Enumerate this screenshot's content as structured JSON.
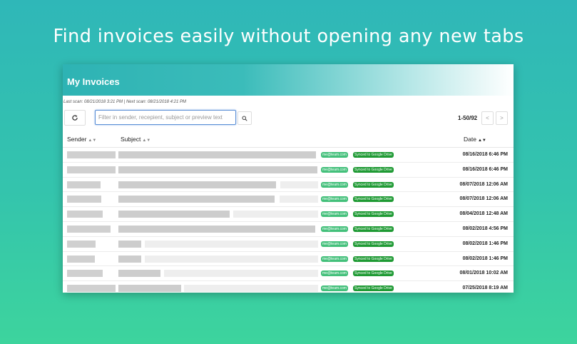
{
  "headline": "Find invoices easily without opening any new tabs",
  "panel": {
    "title": "My Invoices",
    "scan_info": "Last scan: 08/21/2018 3:21 PM | Next scan: 08/21/2018 4:21 PM"
  },
  "toolbar": {
    "refresh_icon": "refresh-icon",
    "filter_placeholder": "Filter in sender, recepient, subject or preview text",
    "search_icon": "search-icon",
    "pagination": "1-50/92",
    "prev_label": "<",
    "next_label": ">"
  },
  "table": {
    "columns": {
      "sender": "Sender",
      "subject": "Subject",
      "date": "Date",
      "sender_sort": "▲▼",
      "subject_sort": "▲▼",
      "date_sort": "▲▼"
    },
    "rows": [
      {
        "email_badge": "me@team.com",
        "sync_badge": "Synced to Google Drive",
        "date": "08/16/2018 6:46 PM"
      },
      {
        "email_badge": "me@team.com",
        "sync_badge": "Synced to Google Drive",
        "date": "08/16/2018 6:46 PM"
      },
      {
        "email_badge": "me@team.com",
        "sync_badge": "Synced to Google Drive",
        "date": "08/07/2018 12:06 AM"
      },
      {
        "email_badge": "me@team.com",
        "sync_badge": "Synced to Google Drive",
        "date": "08/07/2018 12:06 AM"
      },
      {
        "email_badge": "me@team.com",
        "sync_badge": "Synced to Google Drive",
        "date": "08/04/2018 12:48 AM"
      },
      {
        "email_badge": "me@team.com",
        "sync_badge": "Synced to Google Drive",
        "date": "08/02/2018 4:56 PM"
      },
      {
        "email_badge": "me@team.com",
        "sync_badge": "Synced to Google Drive",
        "date": "08/02/2018 1:46 PM"
      },
      {
        "email_badge": "me@team.com",
        "sync_badge": "Synced to Google Drive",
        "date": "08/02/2018 1:46 PM"
      },
      {
        "email_badge": "me@team.com",
        "sync_badge": "Synced to Google Drive",
        "date": "08/01/2018 10:02 AM"
      },
      {
        "email_badge": "me@team.com",
        "sync_badge": "Synced to Google Drive",
        "date": "07/25/2018 8:19 AM"
      }
    ]
  },
  "colors": {
    "accent": "#2eb3b4",
    "email_badge": "#44c07b",
    "sync_badge": "#1f9a34"
  }
}
